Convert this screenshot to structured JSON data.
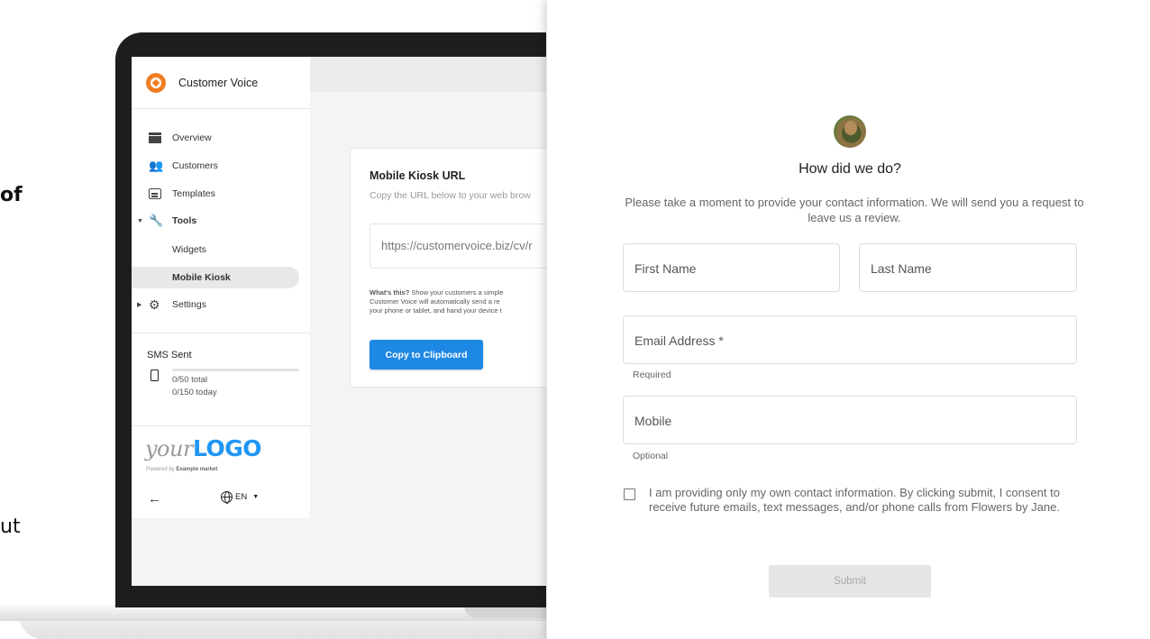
{
  "background_fragments": {
    "of": "of",
    "ut": "ut"
  },
  "app": {
    "brand_name": "Customer Voice",
    "nav": [
      {
        "label": "Overview",
        "icon": "overview-icon"
      },
      {
        "label": "Customers",
        "icon": "customers-icon"
      },
      {
        "label": "Templates",
        "icon": "templates-icon"
      },
      {
        "label": "Tools",
        "icon": "wrench-icon"
      },
      {
        "label": "Widgets"
      },
      {
        "label": "Mobile Kiosk"
      },
      {
        "label": "Settings",
        "icon": "gear-icon"
      }
    ],
    "sms": {
      "title": "SMS Sent",
      "total": "0/50 total",
      "today": "0/150 today",
      "progress": 0
    },
    "logo": {
      "your": "your",
      "logo": "LOGO",
      "powered_prefix": "Powered by ",
      "powered_brand": "Example market"
    },
    "language": "EN",
    "accent": "#1e88e5",
    "brand_color": "#ef7d22"
  },
  "kiosk_card": {
    "title": "Mobile Kiosk URL",
    "subtitle": "Copy the URL below to your web brow",
    "url": "https://customervoice.biz/cv/r",
    "whats_this_bold": "What's this?",
    "whats_this_line1": " Show your customers a simple",
    "whats_this_line2": "Customer Voice will automatically send a re",
    "whats_this_line3": "your phone or tablet, and hand your device t",
    "copy_button": "Copy to Clipboard"
  },
  "form": {
    "title": "How did we do?",
    "subtitle": "Please take a moment to provide your contact information. We will send you a request to leave us a review.",
    "first_name_placeholder": "First Name",
    "last_name_placeholder": "Last Name",
    "email_placeholder": "Email Address *",
    "email_helper": "Required",
    "mobile_placeholder": "Mobile",
    "mobile_helper": "Optional",
    "consent": "I am providing only my own contact information. By clicking submit, I consent to receive future emails, text messages, and/or phone calls from Flowers by Jane.",
    "submit_label": "Submit"
  }
}
